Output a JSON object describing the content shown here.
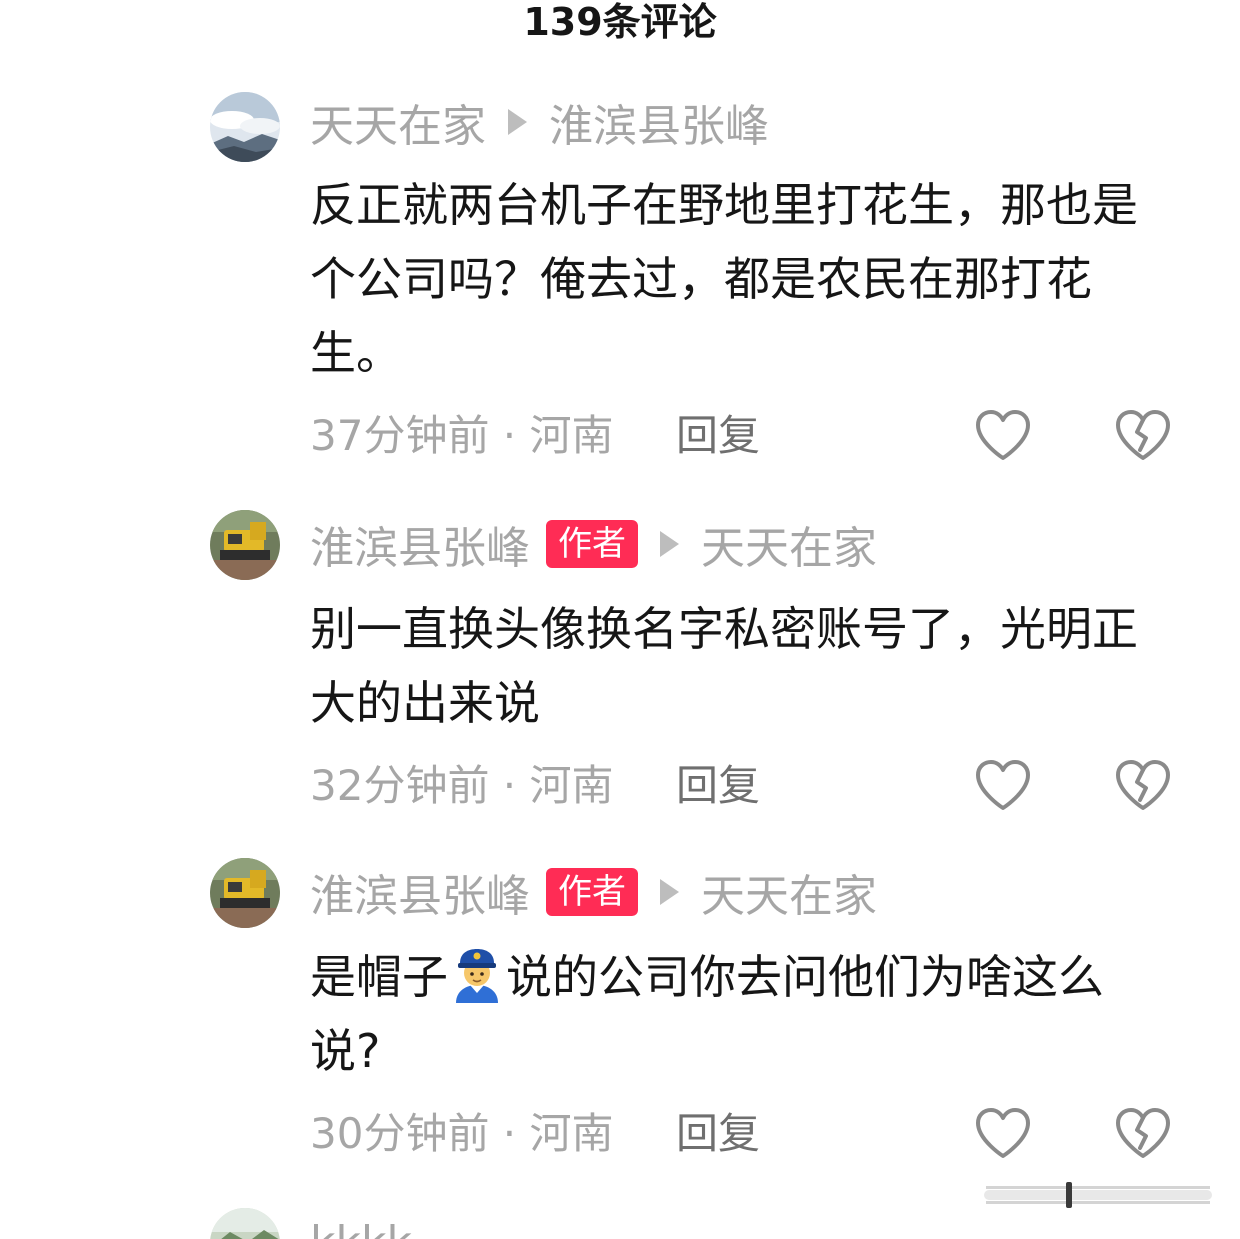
{
  "header": {
    "title": "139条评论"
  },
  "comments": [
    {
      "username": "天天在家",
      "reply_to": "淮滨县张峰",
      "text": "反正就两台机子在野地里打花生，那也是个公司吗？俺去过，都是农民在那打花生。",
      "time_location": "37分钟前 · 河南",
      "reply_label": "回复"
    },
    {
      "username": "淮滨县张峰",
      "badge": "作者",
      "reply_to": "天天在家",
      "text": "别一直换头像换名字私密账号了，光明正大的出来说",
      "time_location": "32分钟前 · 河南",
      "reply_label": "回复"
    },
    {
      "username": "淮滨县张峰",
      "badge": "作者",
      "reply_to": "天天在家",
      "text_before_emoji": "是帽子",
      "text_after_emoji": "说的公司你去问他们为啥这么说?",
      "emoji_icon": "police-officer-emoji",
      "time_location": "30分钟前 · 河南",
      "reply_label": "回复"
    },
    {
      "username": "kkkk"
    }
  ],
  "colors": {
    "badge_bg": "#ff2c55",
    "meta_text": "#a6a6a6",
    "body_text": "#161616"
  }
}
